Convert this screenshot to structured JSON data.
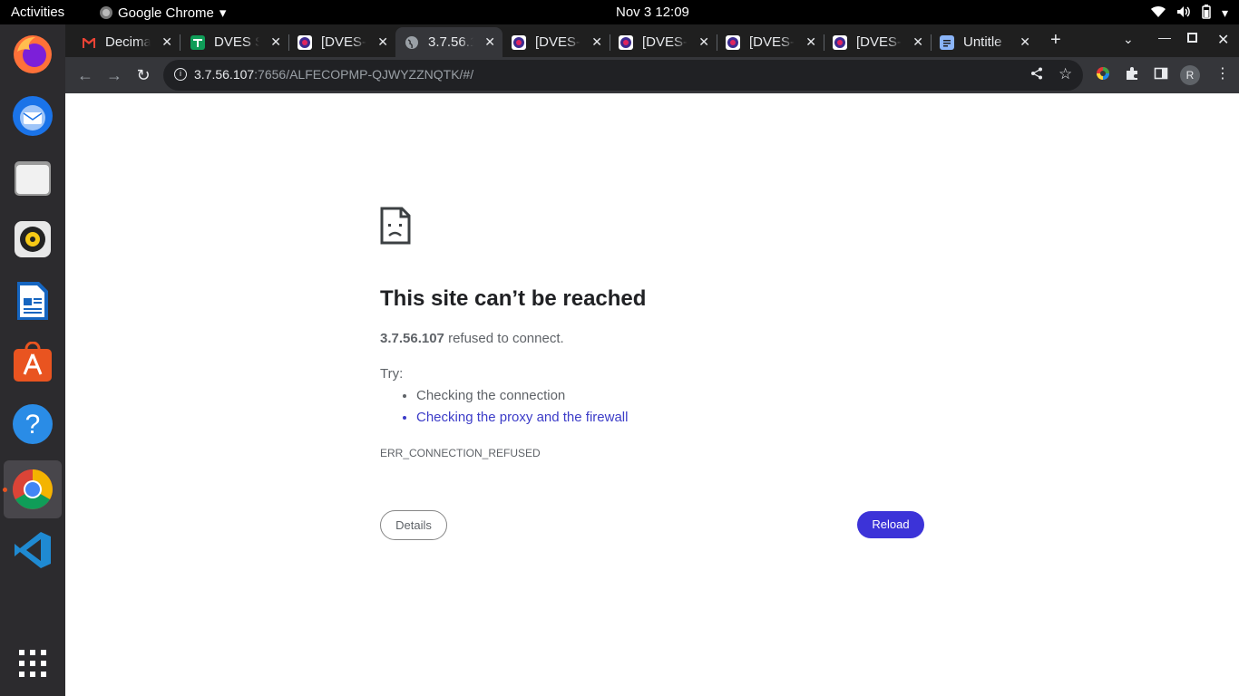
{
  "system": {
    "activities": "Activities",
    "app_name": "Google Chrome",
    "clock": "Nov 3  12:09"
  },
  "tabs": [
    {
      "title": "Decima",
      "favicon": "gmail-icon",
      "color": "#ea4335"
    },
    {
      "title": "DVES S",
      "favicon": "sheets-icon",
      "color": "#0f9d58"
    },
    {
      "title": "[DVES-",
      "favicon": "dves-icon",
      "color": "#e0245e"
    },
    {
      "title": "3.7.56.1",
      "favicon": "globe-icon",
      "color": "#9aa0a6",
      "active": true
    },
    {
      "title": "[DVES-",
      "favicon": "dves-icon",
      "color": "#e0245e"
    },
    {
      "title": "[DVES-",
      "favicon": "dves-icon",
      "color": "#e0245e"
    },
    {
      "title": "[DVES-",
      "favicon": "dves-icon",
      "color": "#e0245e"
    },
    {
      "title": "[DVES-",
      "favicon": "dves-icon",
      "color": "#e0245e"
    },
    {
      "title": "Untitle",
      "favicon": "docs-icon",
      "color": "#8ab4f8"
    }
  ],
  "address": {
    "host": "3.7.56.107",
    "rest": ":7656/ALFECOPMP-QJWYZZNQTK/#/"
  },
  "profile_initial": "R",
  "error": {
    "heading": "This site can’t be reached",
    "host": "3.7.56.107",
    "message_suffix": " refused to connect.",
    "try_label": "Try:",
    "suggestion_1": "Checking the connection",
    "suggestion_2": "Checking the proxy and the firewall",
    "code": "ERR_CONNECTION_REFUSED",
    "details_label": "Details",
    "reload_label": "Reload"
  },
  "colors": {
    "reload_button": "#3c33d8",
    "link": "#3c3cc8",
    "dock_bg": "#2c2b2e",
    "tabstrip_bg": "#1f1f1f"
  }
}
